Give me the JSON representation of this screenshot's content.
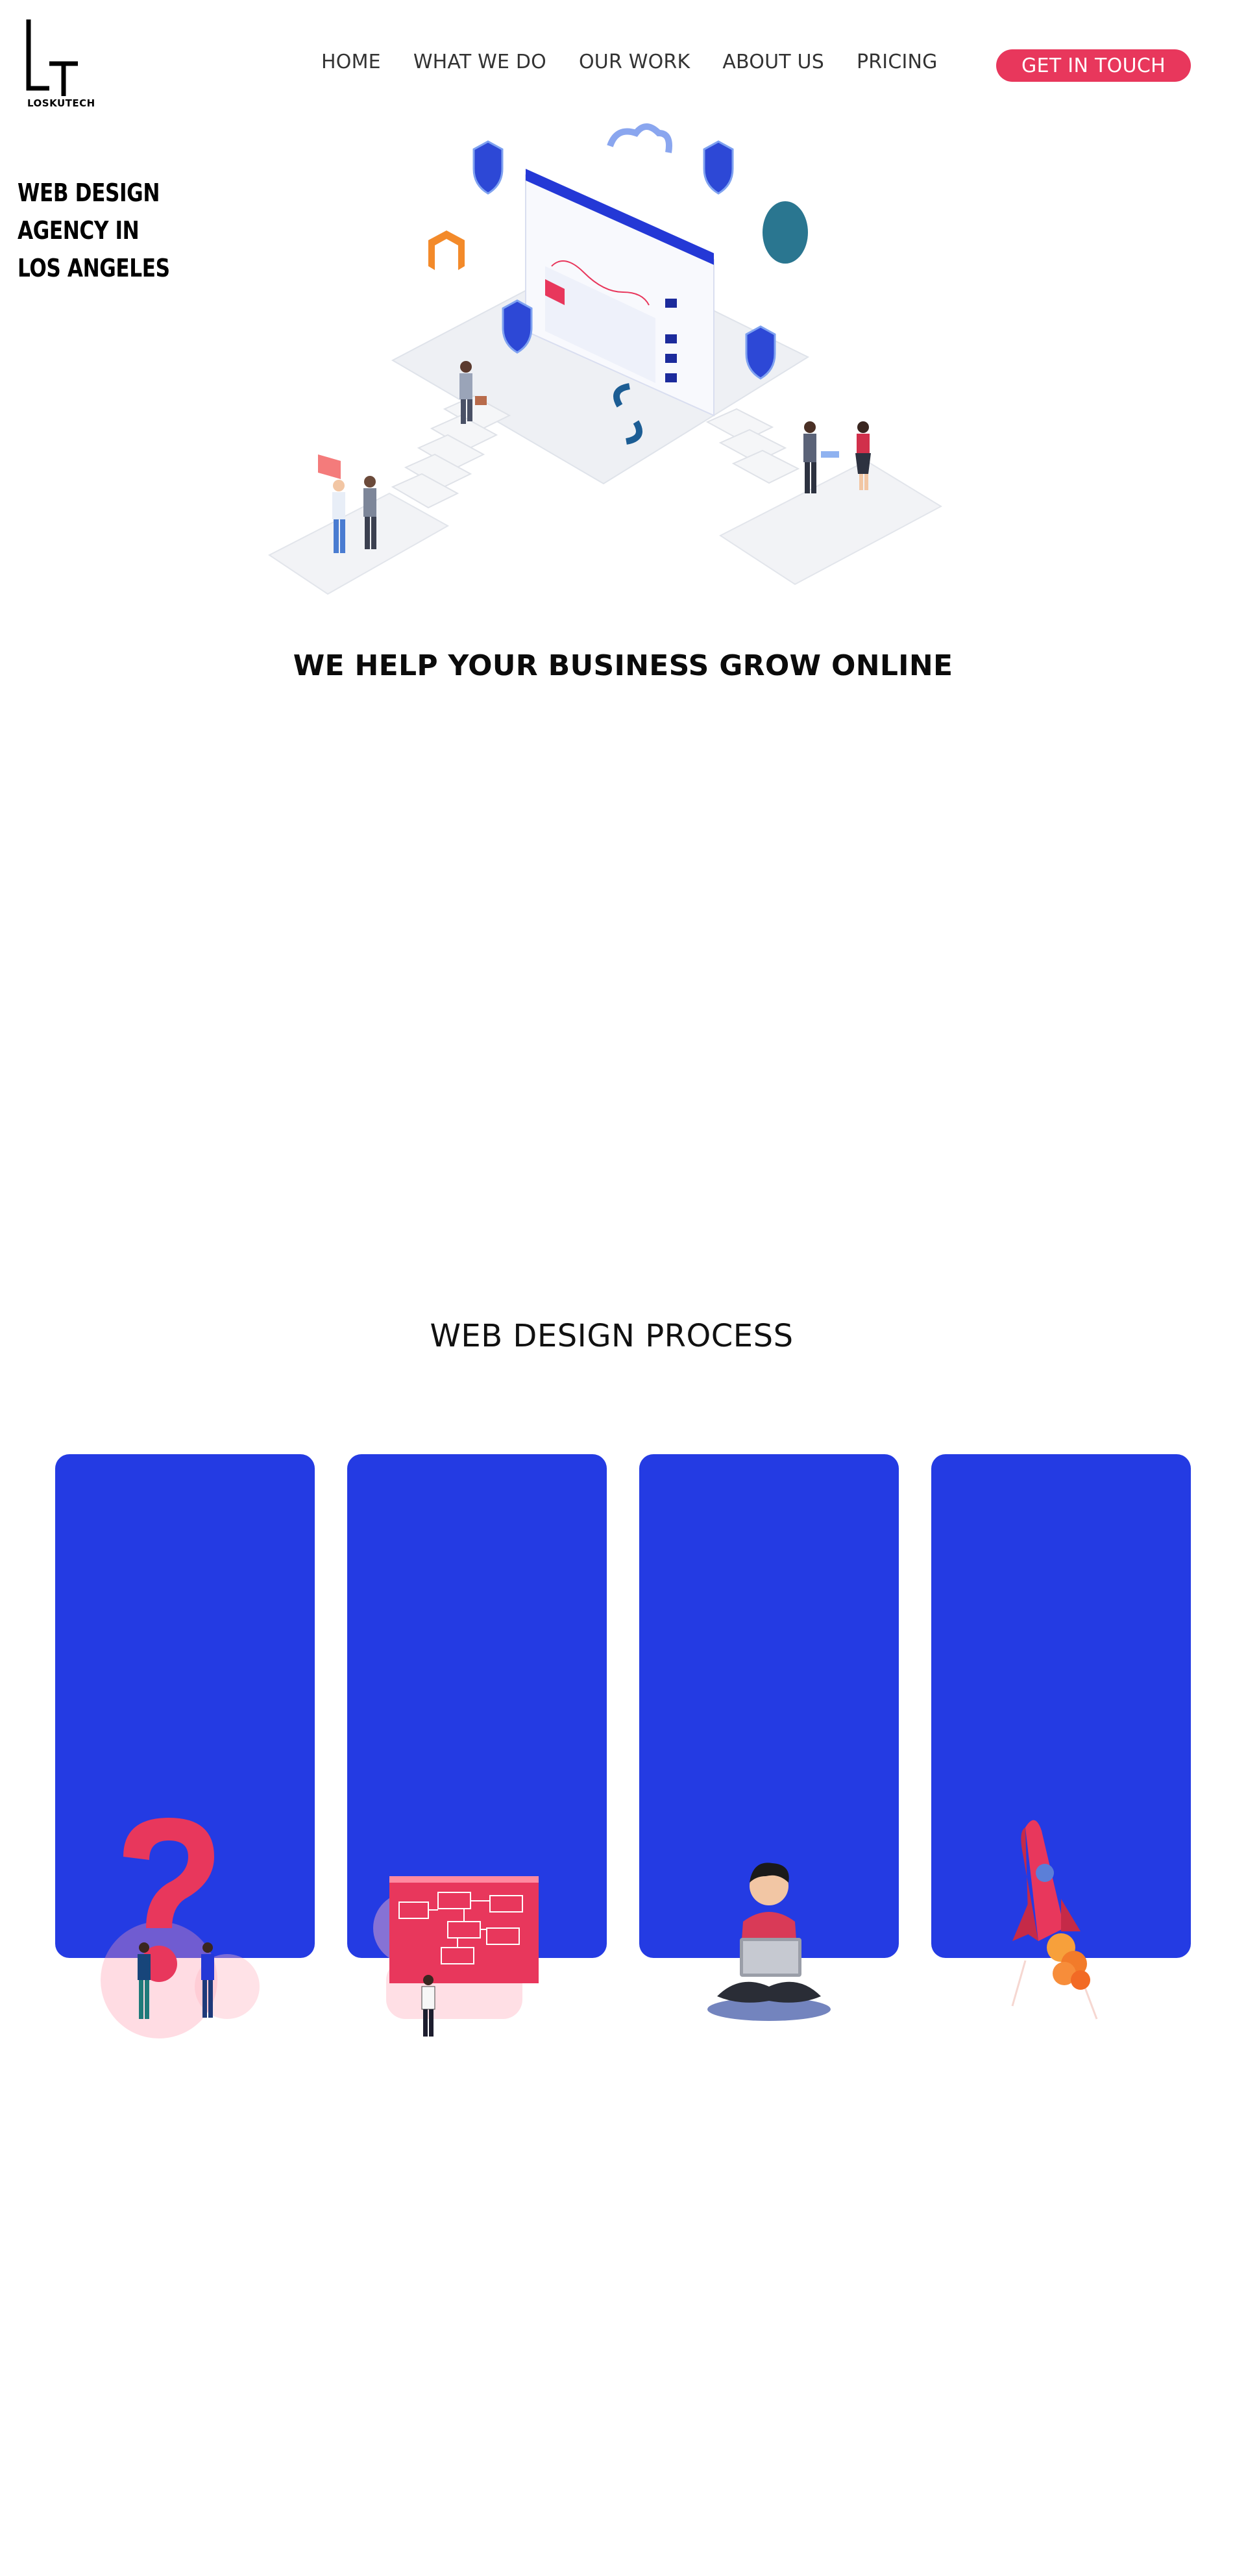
{
  "header": {
    "logo_text": "LOSKUTECH",
    "nav": [
      "HOME",
      "WHAT WE DO",
      "OUR WORK",
      "ABOUT US",
      "PRICING"
    ],
    "cta_label": "GET IN TOUCH"
  },
  "hero": {
    "agency_line1": "WEB DESIGN AGENCY IN",
    "agency_line2": "LOS ANGELES",
    "heading": "WE HELP YOUR BUSINESS GROW ONLINE"
  },
  "process": {
    "heading": "WEB DESIGN PROCESS",
    "steps": [
      {
        "icon": "question-illustration-icon"
      },
      {
        "icon": "sitemap-illustration-icon"
      },
      {
        "icon": "developer-laptop-illustration-icon"
      },
      {
        "icon": "rocket-launch-illustration-icon"
      }
    ]
  },
  "colors": {
    "accent": "#e8375c",
    "card_blue": "#243be3",
    "shield_blue": "#2d48d6"
  }
}
